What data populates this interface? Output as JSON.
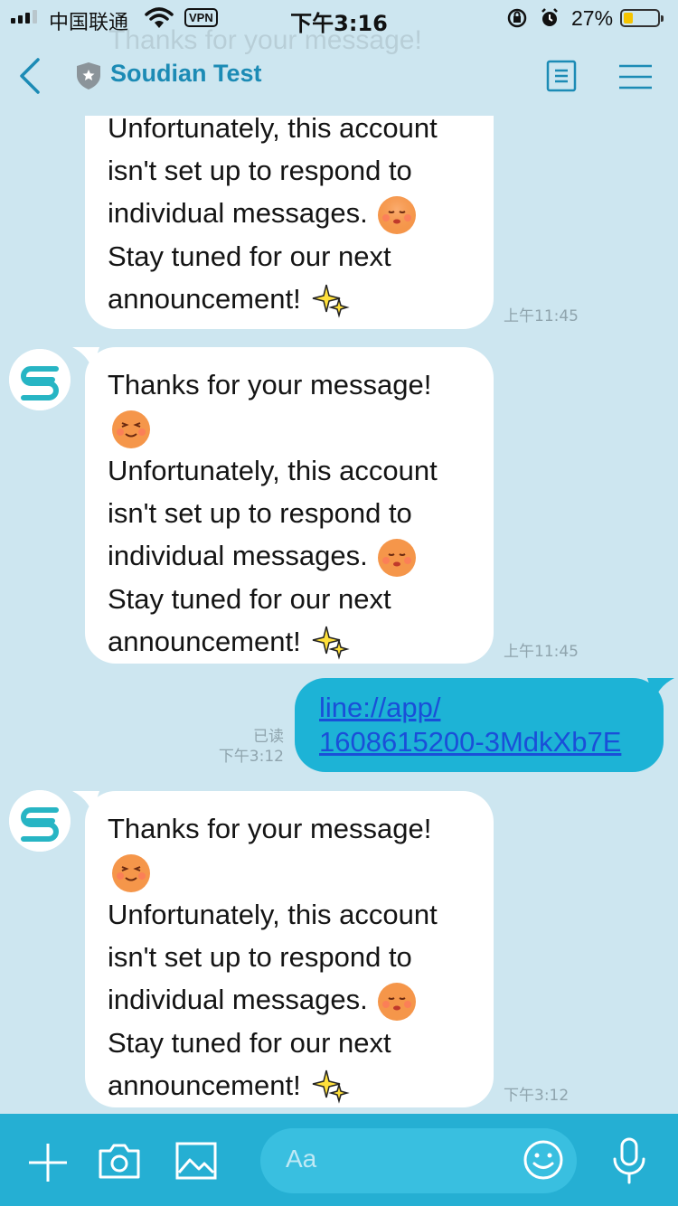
{
  "status_bar": {
    "carrier": "中国联通",
    "vpn": "VPN",
    "time": "下午3:16",
    "battery": "27%",
    "battery_level": 0.27
  },
  "header": {
    "ghost_text": "Thanks for your message!",
    "title": "Soudian Test",
    "icons": [
      "back-icon",
      "shield-icon",
      "notes-icon",
      "menu-icon"
    ]
  },
  "messages": [
    {
      "from": "bot",
      "lines": [
        "Unfortunately, this account",
        "isn't set up to respond to",
        "individual messages.",
        "Stay tuned for our next",
        "announcement!"
      ],
      "time": "上午11:45"
    },
    {
      "from": "bot",
      "lines": [
        "Thanks for your message!",
        "Unfortunately, this account",
        "isn't set up to respond to",
        "individual messages.",
        "Stay tuned for our next",
        "announcement!"
      ],
      "time": "上午11:45"
    },
    {
      "from": "me",
      "link_lines": [
        "line://app/",
        "1608615200-3MdkXb7E"
      ],
      "read": "已读",
      "time": "下午3:12"
    },
    {
      "from": "bot",
      "lines": [
        "Thanks for your message!",
        "Unfortunately, this account",
        "isn't set up to respond to",
        "individual messages.",
        "Stay tuned for our next",
        "announcement!"
      ],
      "time": "下午3:12"
    }
  ],
  "input": {
    "placeholder": "Aa"
  },
  "colors": {
    "background": "#cde6f0",
    "accent": "#1c8bb5",
    "outgoing_bubble": "#1db3d6",
    "bottom_bar": "#25afd3",
    "link": "#1a4fd8"
  }
}
